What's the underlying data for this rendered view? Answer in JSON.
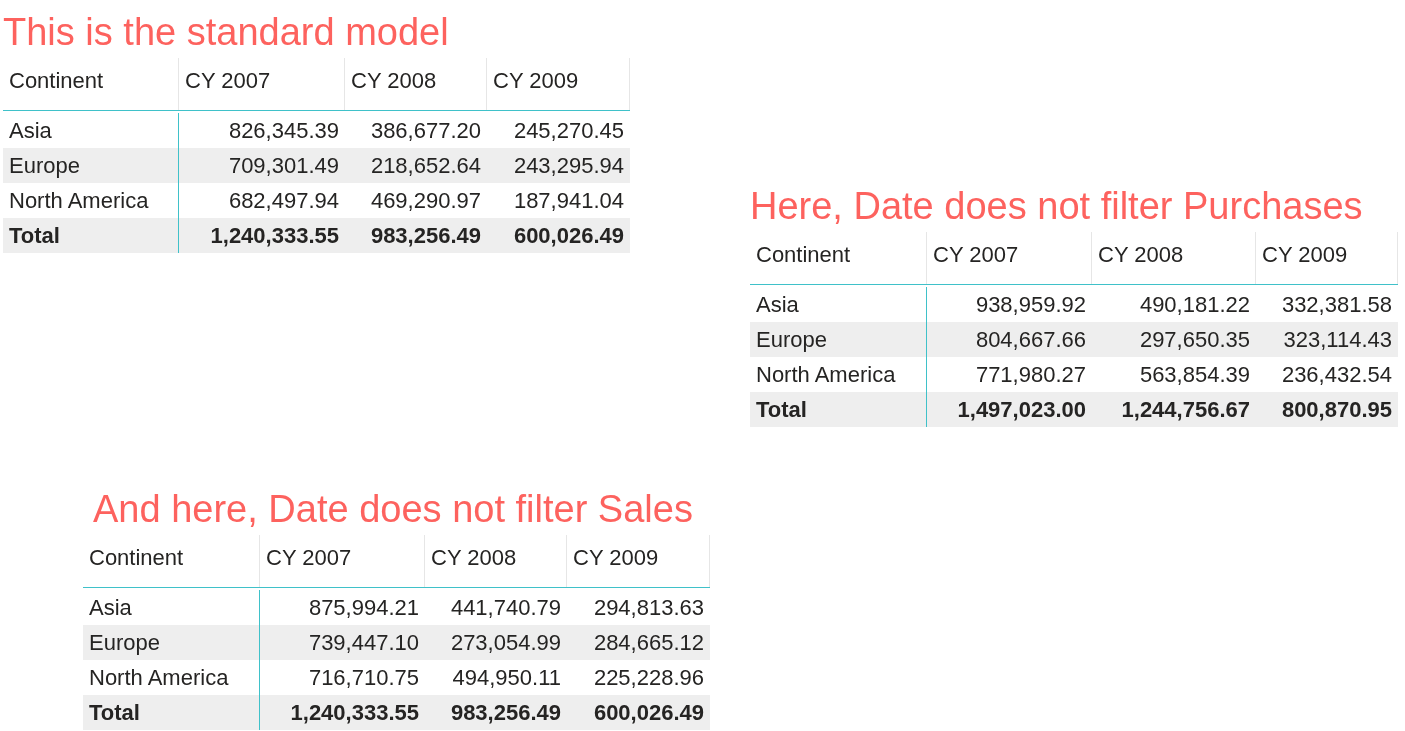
{
  "visuals": [
    {
      "title": "This is the standard model",
      "columns": [
        "Continent",
        "CY 2007",
        "CY 2008",
        "CY 2009"
      ],
      "rows": [
        {
          "kind": "data",
          "cells": [
            "Asia",
            "826,345.39",
            "386,677.20",
            "245,270.45"
          ]
        },
        {
          "kind": "data",
          "cells": [
            "Europe",
            "709,301.49",
            "218,652.64",
            "243,295.94"
          ]
        },
        {
          "kind": "data",
          "cells": [
            "North America",
            "682,497.94",
            "469,290.97",
            "187,941.04"
          ]
        },
        {
          "kind": "total",
          "cells": [
            "Total",
            "1,240,333.55",
            "983,256.49",
            "600,026.49"
          ]
        }
      ]
    },
    {
      "title": "Here, Date does not filter Purchases",
      "columns": [
        "Continent",
        "CY 2007",
        "CY 2008",
        "CY 2009"
      ],
      "rows": [
        {
          "kind": "data",
          "cells": [
            "Asia",
            "938,959.92",
            "490,181.22",
            "332,381.58"
          ]
        },
        {
          "kind": "data",
          "cells": [
            "Europe",
            "804,667.66",
            "297,650.35",
            "323,114.43"
          ]
        },
        {
          "kind": "data",
          "cells": [
            "North America",
            "771,980.27",
            "563,854.39",
            "236,432.54"
          ]
        },
        {
          "kind": "total",
          "cells": [
            "Total",
            "1,497,023.00",
            "1,244,756.67",
            "800,870.95"
          ]
        }
      ]
    },
    {
      "title": "And here, Date does not filter Sales",
      "columns": [
        "Continent",
        "CY 2007",
        "CY 2008",
        "CY 2009"
      ],
      "rows": [
        {
          "kind": "data",
          "cells": [
            "Asia",
            "875,994.21",
            "441,740.79",
            "294,813.63"
          ]
        },
        {
          "kind": "data",
          "cells": [
            "Europe",
            "739,447.10",
            "273,054.99",
            "284,665.12"
          ]
        },
        {
          "kind": "data",
          "cells": [
            "North America",
            "716,710.75",
            "494,950.11",
            "225,228.96"
          ]
        },
        {
          "kind": "total",
          "cells": [
            "Total",
            "1,240,333.55",
            "983,256.49",
            "600,026.49"
          ]
        }
      ]
    }
  ]
}
